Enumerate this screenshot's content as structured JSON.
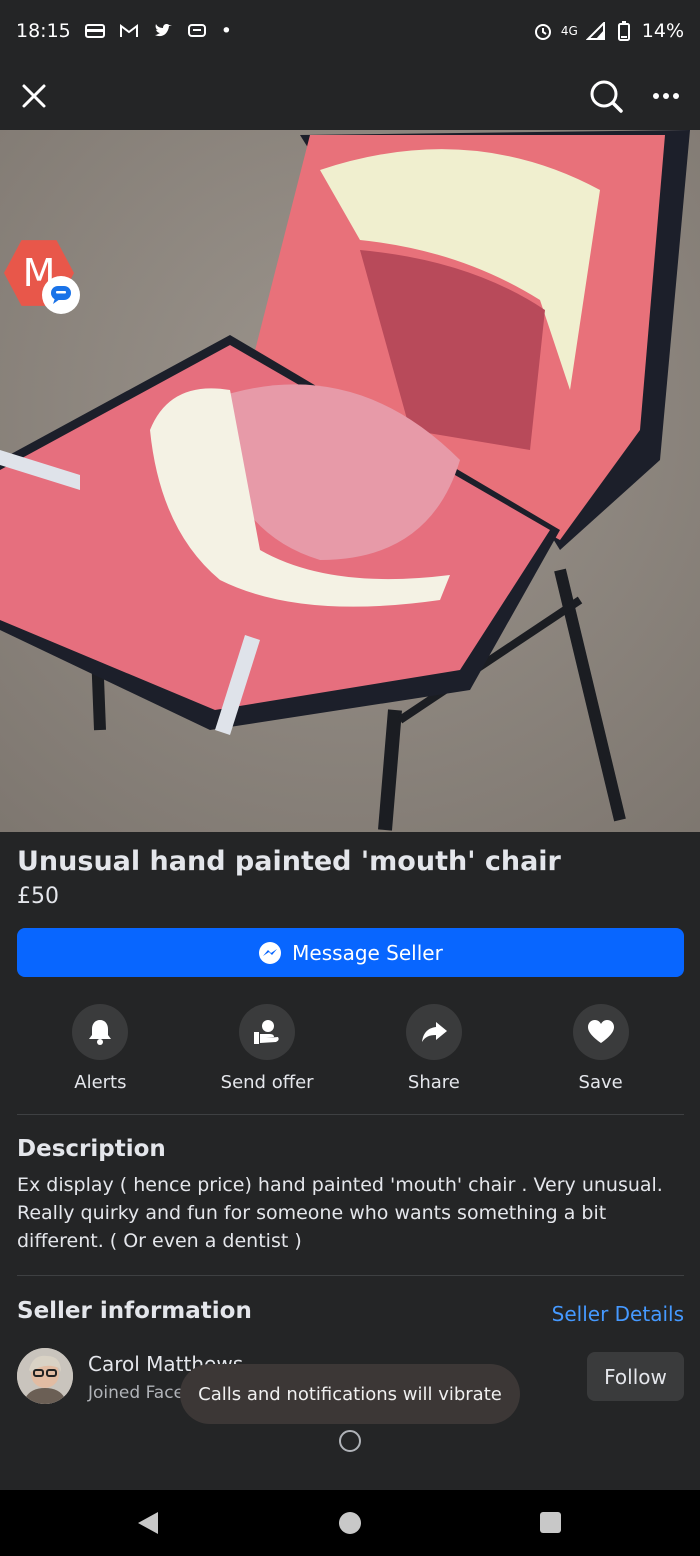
{
  "status_bar": {
    "time": "18:15",
    "dot": "•",
    "network": "4G",
    "battery": "14%"
  },
  "app_bar": {
    "close_icon": "close-icon",
    "search_icon": "search-icon",
    "more_icon": "more-icon"
  },
  "chat_head": {
    "letter": "M"
  },
  "listing": {
    "title": "Unusual hand painted  'mouth'  chair",
    "price": "£50",
    "message_button": "Message Seller"
  },
  "actions": [
    {
      "label": "Alerts",
      "icon": "bell-icon"
    },
    {
      "label": "Send offer",
      "icon": "offer-icon"
    },
    {
      "label": "Share",
      "icon": "share-icon"
    },
    {
      "label": "Save",
      "icon": "heart-icon"
    }
  ],
  "description": {
    "heading": "Description",
    "text": "Ex display ( hence price)  hand painted 'mouth' chair . Very unusual. Really quirky and fun  for someone who wants something a bit different. ( Or even a dentist )"
  },
  "seller": {
    "heading": "Seller information",
    "details_link": "Seller Details",
    "name": "Carol Matthews",
    "joined": "Joined Facebook",
    "follow_button": "Follow"
  },
  "toast": "Calls and notifications will vibrate",
  "colors": {
    "background": "#242526",
    "accent": "#0866ff",
    "link": "#4599ff"
  }
}
